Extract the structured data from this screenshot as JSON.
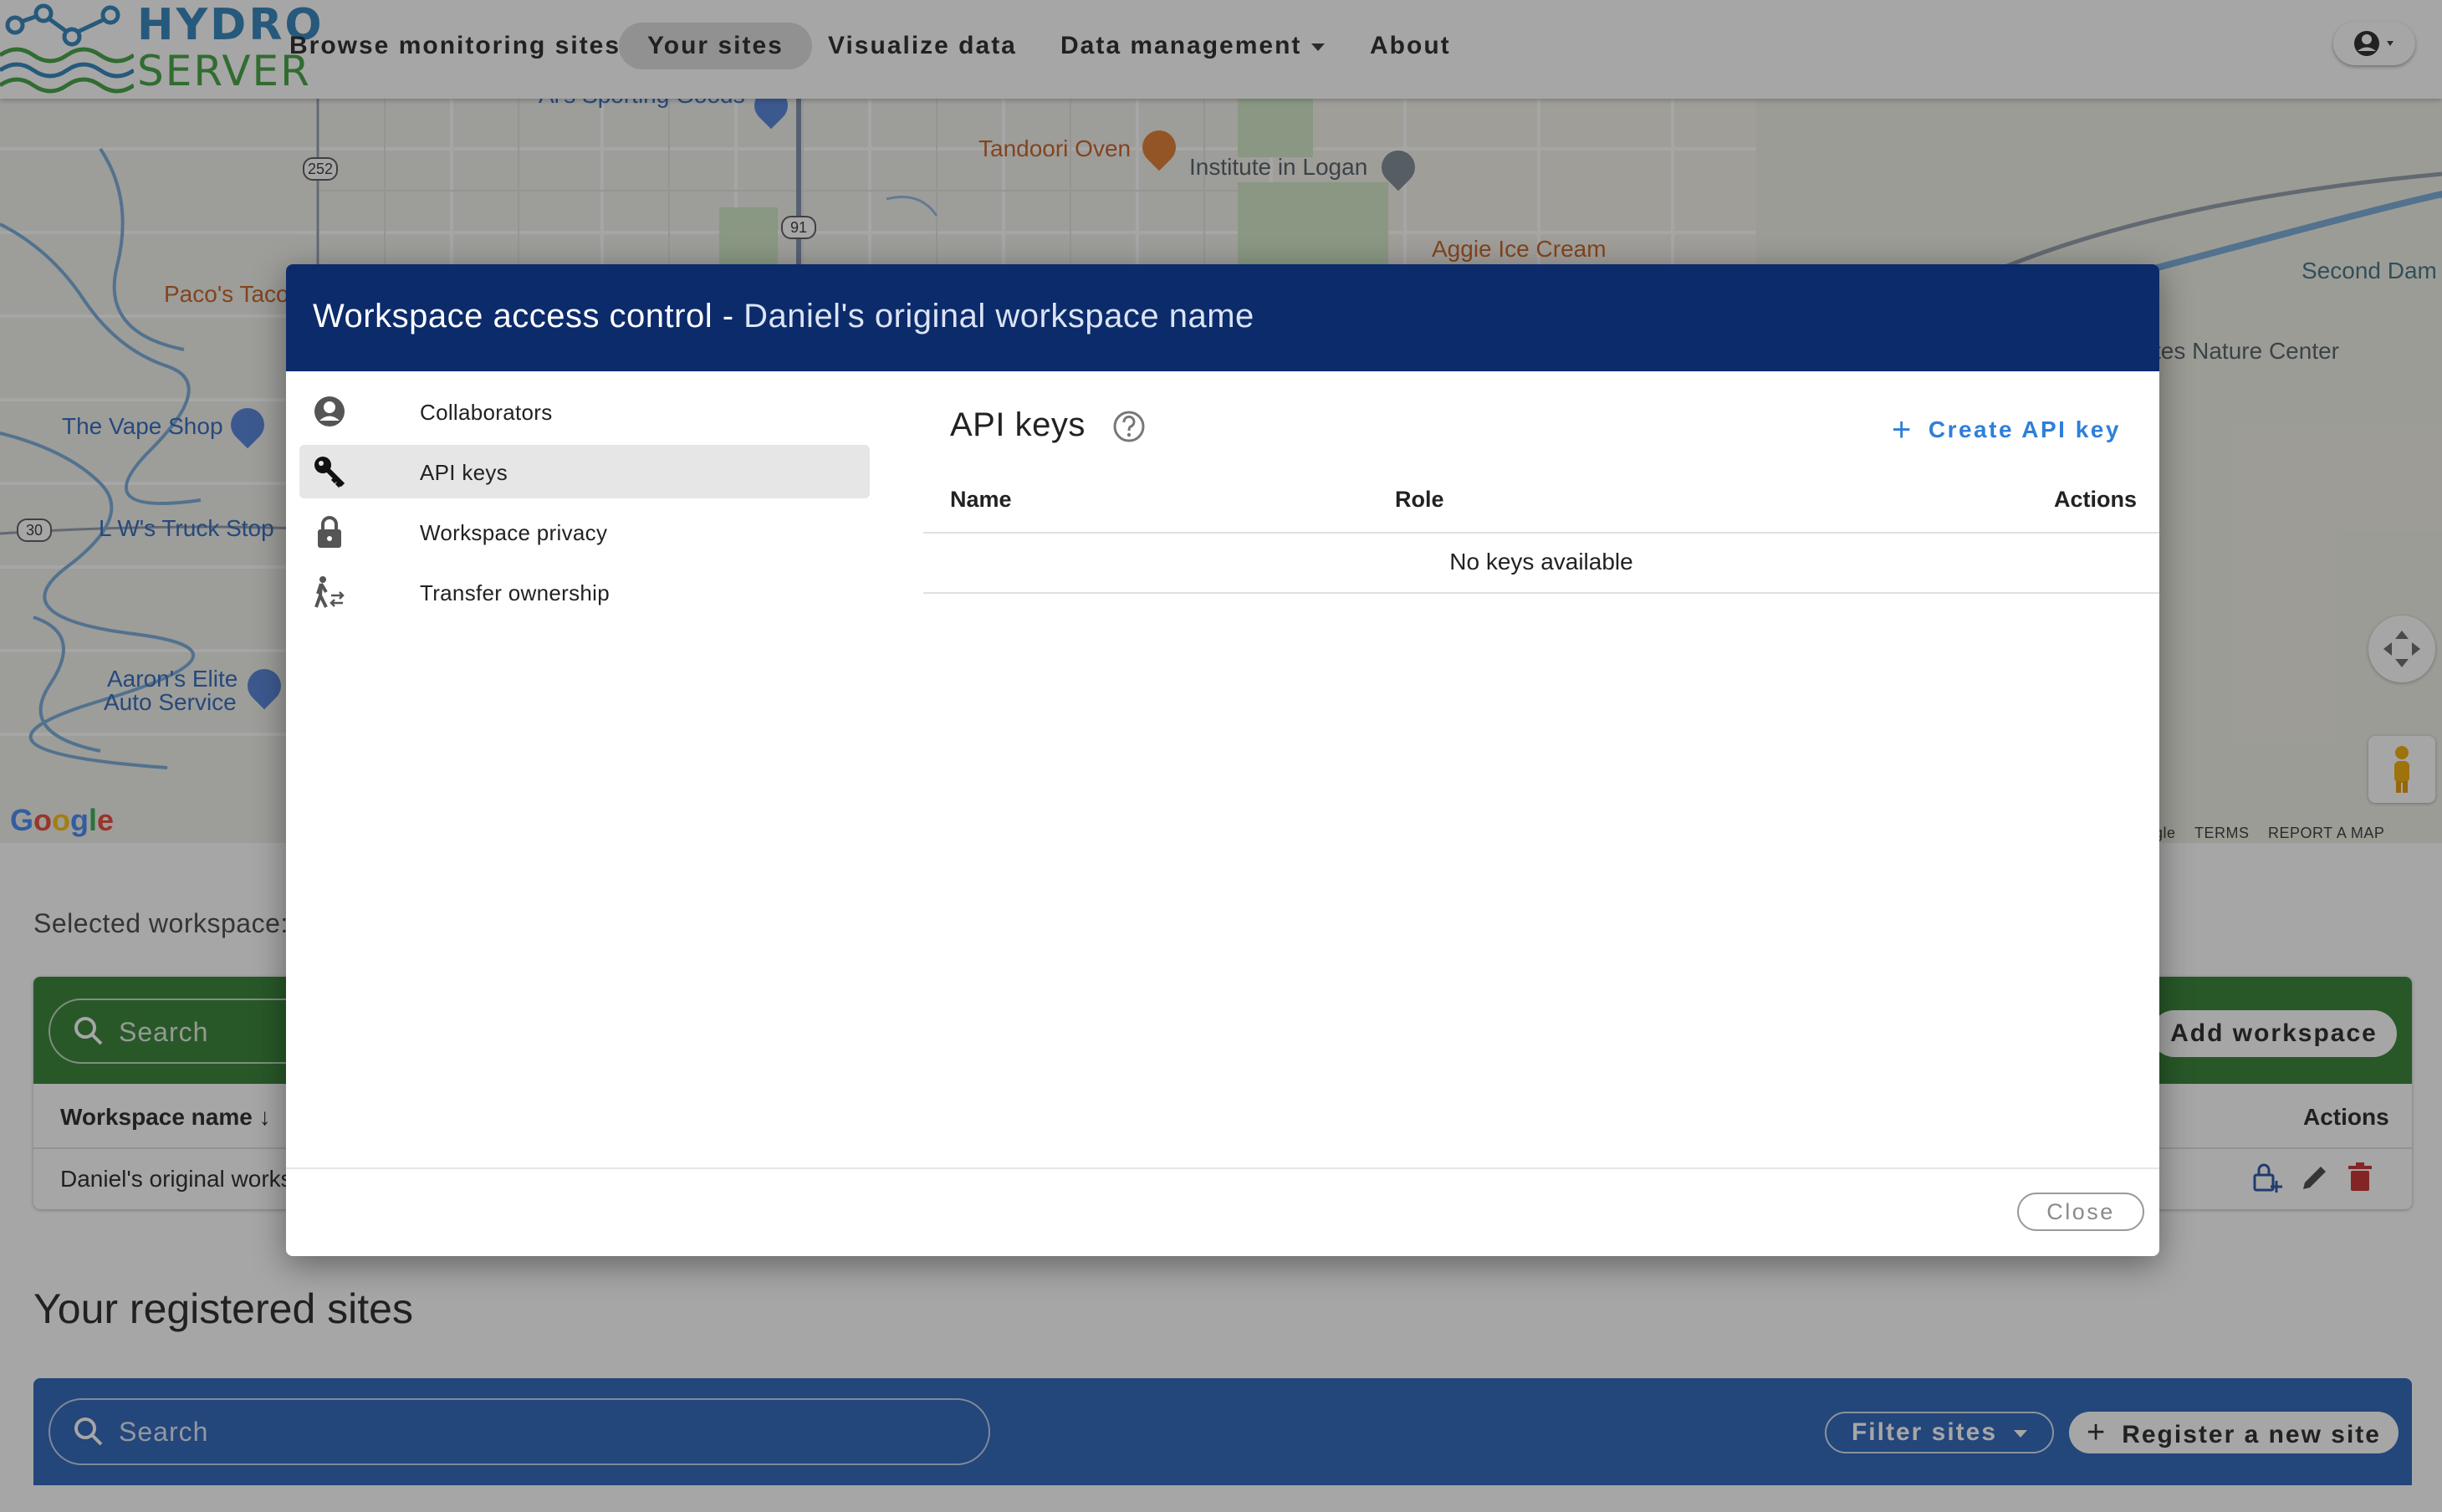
{
  "header": {
    "logo_top": "HYDRO",
    "logo_bottom": "SERVER",
    "nav": [
      {
        "label": "Browse monitoring sites",
        "active": false
      },
      {
        "label": "Your sites",
        "active": true
      },
      {
        "label": "Visualize data",
        "active": false
      },
      {
        "label": "Data management",
        "active": false,
        "dropdown": true
      },
      {
        "label": "About",
        "active": false
      }
    ],
    "account_icon": "account-circle-icon"
  },
  "map": {
    "labels": {
      "sporting": "Al's Sporting Goods",
      "tandoori": "Tandoori Oven",
      "institute": "Institute in Logan",
      "aggie": "Aggie Ice Cream",
      "second_dam": "Second Dam",
      "nature_center": "tes Nature Center",
      "pacos": "Paco's Taco",
      "vape": "The Vape Shop",
      "truck_stop": "L W's Truck Stop",
      "aarons_1": "Aaron's Elite",
      "aarons_2": "Auto Service"
    },
    "route_shields": {
      "r252": "252",
      "r91": "91",
      "r30": "30"
    },
    "attribution": {
      "brand": "Google",
      "cut_brand": "gle",
      "terms": "TERMS",
      "report": "REPORT A MAP ERROR"
    }
  },
  "workspace_section": {
    "selected_label": "Selected workspace:",
    "search_placeholder": "Search",
    "add_button": "Add workspace",
    "columns": {
      "name": "Workspace name",
      "actions": "Actions"
    },
    "row": {
      "name": "Daniel's original works"
    }
  },
  "sites_section": {
    "title": "Your registered sites",
    "search_placeholder": "Search",
    "filter_button": "Filter sites",
    "register_button": "Register a new site"
  },
  "dialog": {
    "title": "Workspace access control",
    "separator": " - ",
    "workspace_name": "Daniel's original workspace name",
    "sidebar": [
      {
        "label": "Collaborators",
        "icon": "account-circle-icon",
        "active": false
      },
      {
        "label": "API keys",
        "icon": "key-icon",
        "active": true
      },
      {
        "label": "Workspace privacy",
        "icon": "lock-icon",
        "active": false
      },
      {
        "label": "Transfer ownership",
        "icon": "transfer-person-icon",
        "active": false
      }
    ],
    "pane": {
      "title": "API keys",
      "help_icon": "help-circle-icon",
      "create_button": "Create API key",
      "columns": {
        "name": "Name",
        "role": "Role",
        "actions": "Actions"
      },
      "empty": "No keys available"
    },
    "close_button": "Close"
  }
}
